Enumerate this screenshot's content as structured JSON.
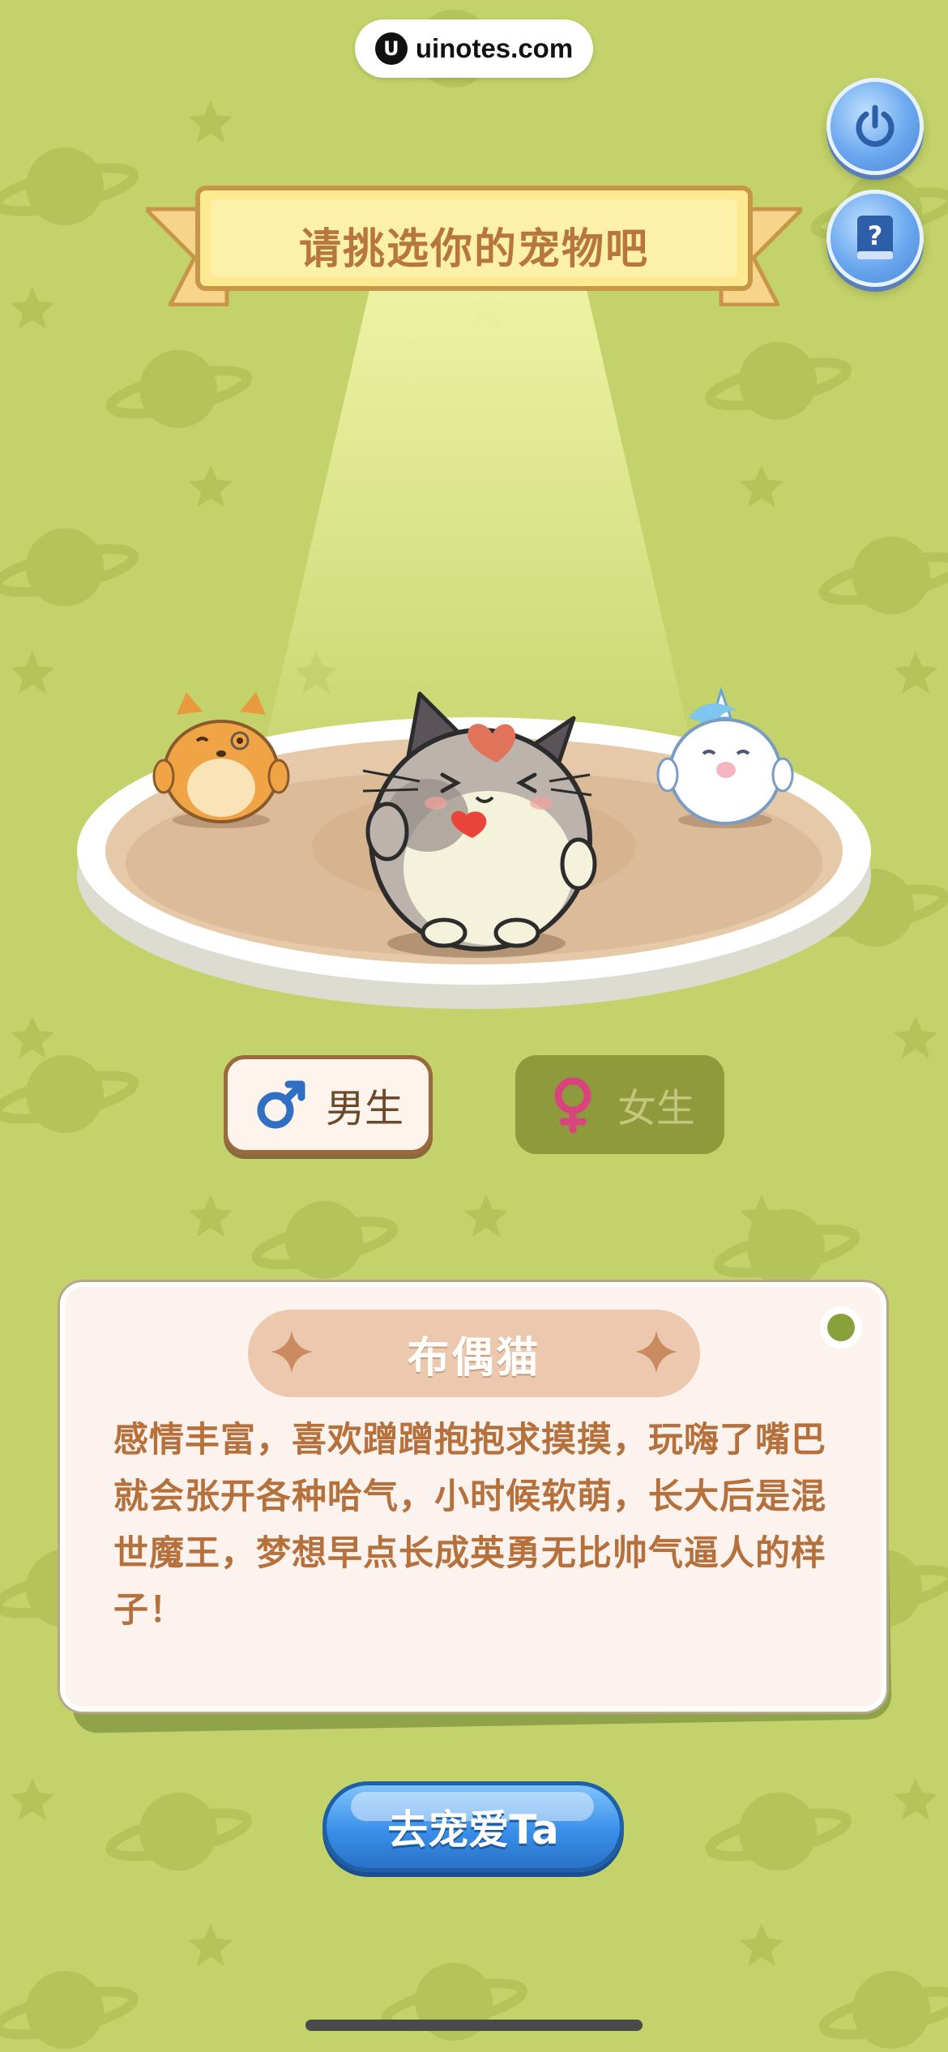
{
  "watermark": {
    "logo_glyph": "U",
    "text": "uinotes.com"
  },
  "top_buttons": {
    "power_icon": "power-icon",
    "help_icon": "help-book-icon"
  },
  "banner": {
    "title": "请挑选你的宠物吧"
  },
  "pets": [
    "shiba-dog",
    "ragdoll-cat",
    "white-unicorn"
  ],
  "gender": {
    "male_label": "男生",
    "female_label": "女生",
    "selected": "male"
  },
  "pet_card": {
    "name": "布偶猫",
    "description": "感情丰富，喜欢蹭蹭抱抱求摸摸，玩嗨了嘴巴就会张开各种哈气，小时候软萌，长大后是混世魔王，梦想早点长成英勇无比帅气逼人的样子！"
  },
  "cta": {
    "label": "去宠爱Ta"
  },
  "colors": {
    "background": "#c3d26a",
    "banner_fill": "#fde98f",
    "banner_text": "#b7773c",
    "card_text": "#b5703b",
    "cta_blue": "#3a8fe8",
    "male_blue": "#2f6fc4",
    "female_pink": "#d8457e"
  }
}
